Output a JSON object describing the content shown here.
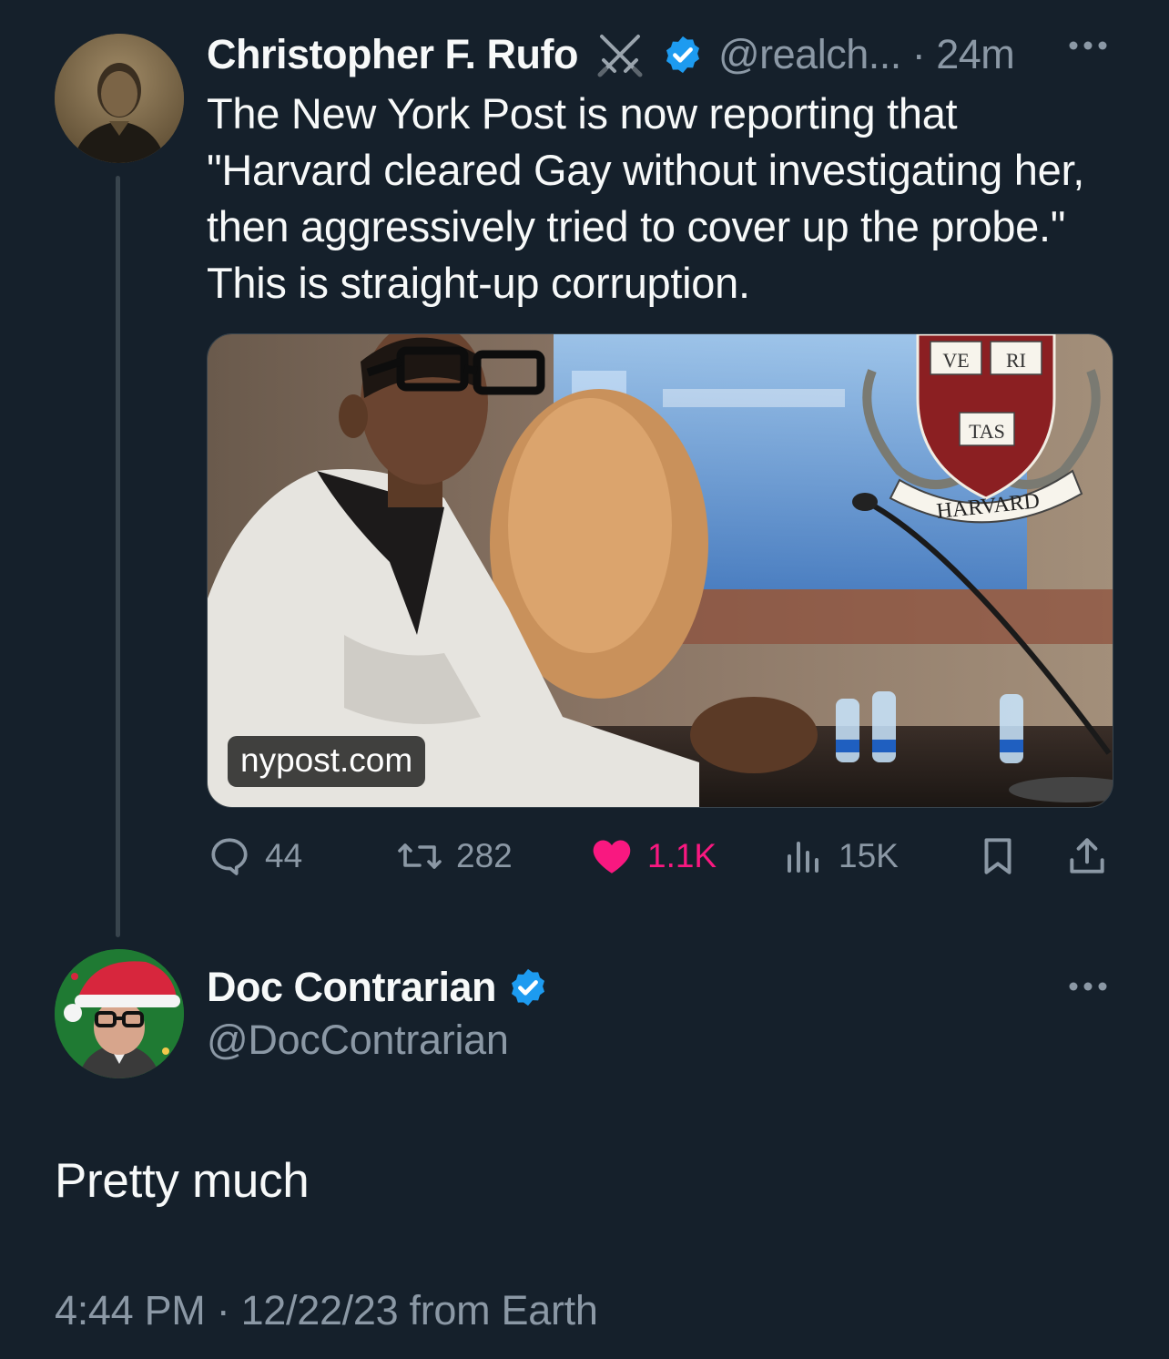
{
  "parent_tweet": {
    "display_name": "Christopher F. Rufo",
    "name_emoji": "crossed-swords-icon",
    "handle_time": "@realch... · 24m",
    "text": "The New York Post is now reporting that \"Harvard cleared Gay without investigating her, then aggressively tried to cover up the probe.\" This is straight-up corruption.",
    "media": {
      "source": "nypost.com",
      "shield_words": [
        "VE",
        "RI",
        "TAS"
      ],
      "banner": "HARVARD"
    },
    "actions": {
      "replies": "44",
      "retweets": "282",
      "likes": "1.1K",
      "views": "15K"
    }
  },
  "reply_tweet": {
    "display_name": "Doc Contrarian",
    "handle": "@DocContrarian",
    "text": "Pretty much",
    "timestamp": "4:44 PM · 12/22/23 from Earth"
  },
  "colors": {
    "background": "#15202b",
    "text_primary": "#f7f9f9",
    "text_secondary": "#8b98a5",
    "verified_blue": "#1d9bf0",
    "like_pink": "#f91880",
    "thread_line": "#38444d"
  }
}
